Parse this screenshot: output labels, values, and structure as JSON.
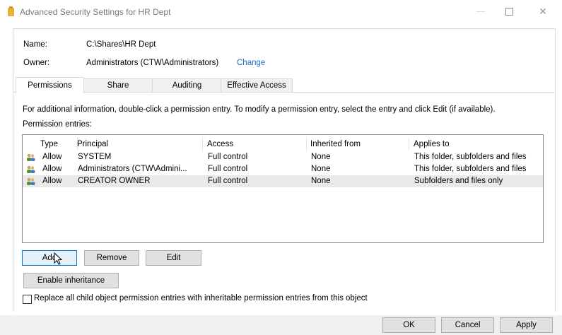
{
  "window": {
    "title": "Advanced Security Settings for HR Dept",
    "min_glyph": "—",
    "close_glyph": "✕"
  },
  "info": {
    "name_label": "Name:",
    "name_value": "C:\\Shares\\HR Dept",
    "owner_label": "Owner:",
    "owner_value": "Administrators (CTW\\Administrators)",
    "change_link": "Change"
  },
  "tabs": [
    {
      "label": "Permissions",
      "active": true
    },
    {
      "label": "Share",
      "active": false
    },
    {
      "label": "Auditing",
      "active": false
    },
    {
      "label": "Effective Access",
      "active": false
    }
  ],
  "main": {
    "instructions": "For additional information, double-click a permission entry. To modify a permission entry, select the entry and click Edit (if available).",
    "entries_label": "Permission entries:"
  },
  "table": {
    "columns": [
      "Type",
      "Principal",
      "Access",
      "Inherited from",
      "Applies to"
    ],
    "rows": [
      {
        "type": "Allow",
        "principal": "SYSTEM",
        "access": "Full control",
        "inherited": "None",
        "applies": "This folder, subfolders and files",
        "selected": false
      },
      {
        "type": "Allow",
        "principal": "Administrators (CTW\\Admini...",
        "access": "Full control",
        "inherited": "None",
        "applies": "This folder, subfolders and files",
        "selected": false
      },
      {
        "type": "Allow",
        "principal": "CREATOR OWNER",
        "access": "Full control",
        "inherited": "None",
        "applies": "Subfolders and files only",
        "selected": true
      }
    ]
  },
  "buttons": {
    "add": "Add",
    "remove": "Remove",
    "edit": "Edit",
    "enable_inheritance": "Enable inheritance",
    "ok": "OK",
    "cancel": "Cancel",
    "apply": "Apply"
  },
  "checkbox": {
    "label": "Replace all child object permission entries with inheritable permission entries from this object",
    "checked": false
  },
  "colors": {
    "link": "#1a6fc4",
    "focus_border": "#0078d7",
    "selected_row": "#e9e9e9"
  }
}
